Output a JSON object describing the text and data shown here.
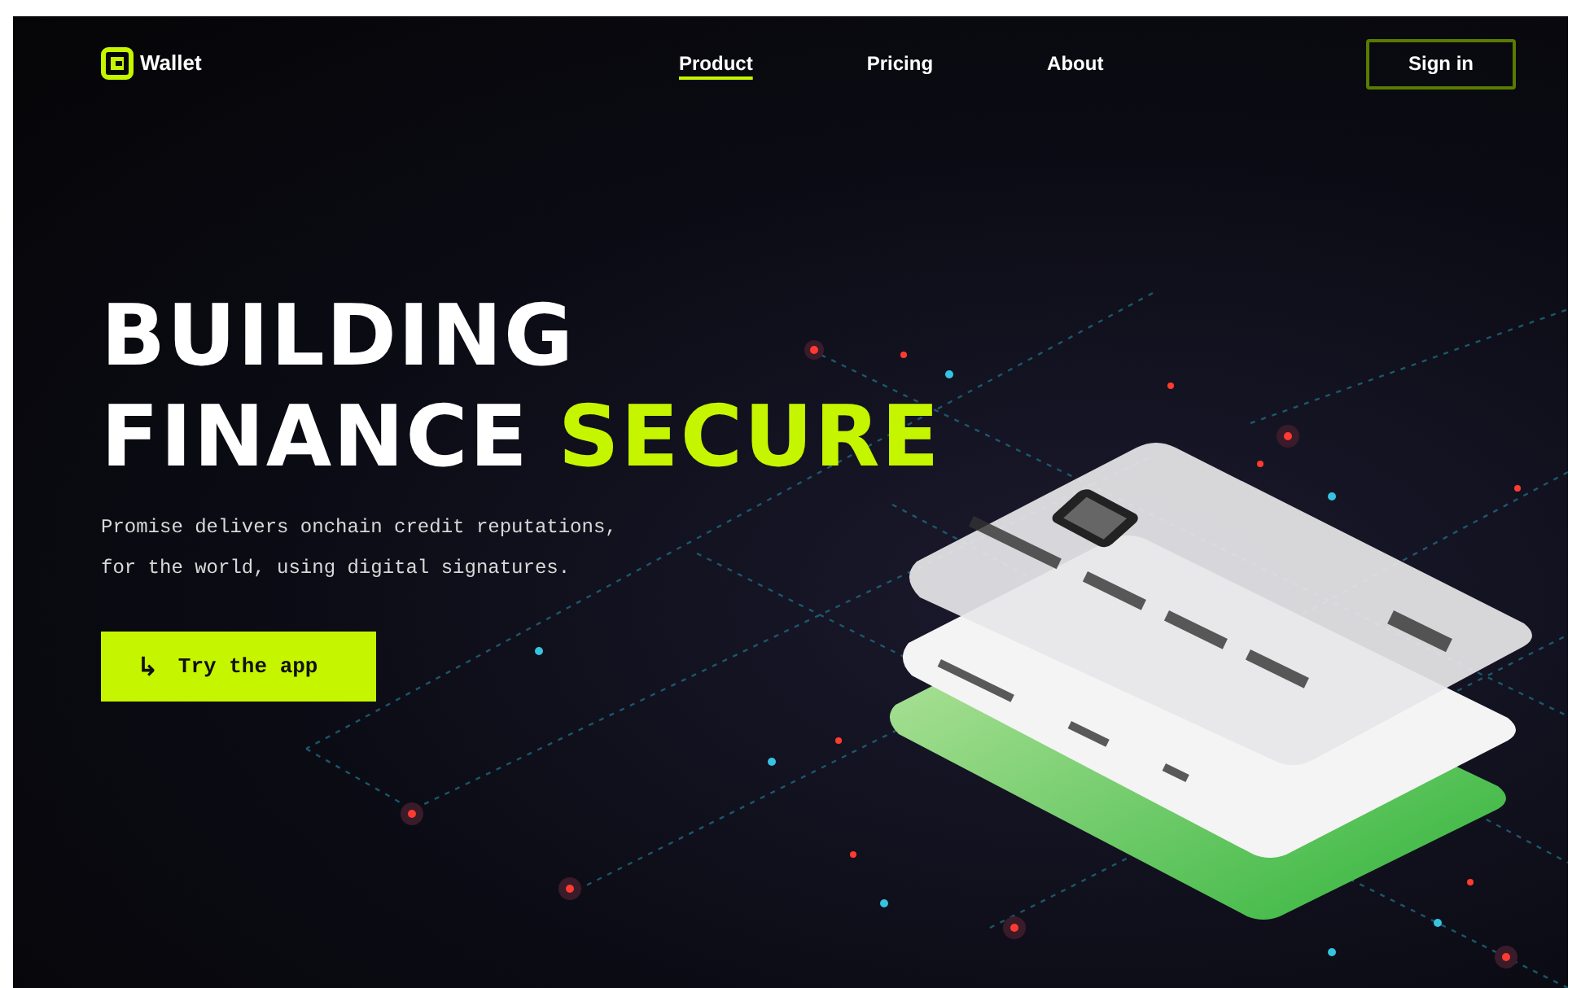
{
  "brand": {
    "name": "Wallet"
  },
  "nav": [
    {
      "label": "Product",
      "selected": true
    },
    {
      "label": "Pricing",
      "selected": false
    },
    {
      "label": "About",
      "selected": false
    }
  ],
  "sign_in": "Sign in",
  "headline": {
    "line1": "BUILDING",
    "line2_plain": "FINANCE",
    "line2_accent": "SECURE"
  },
  "description": "Promise delivers onchain credit reputations,\nfor the world, using digital signatures.",
  "cta": {
    "icon": "↳",
    "label": "Try the app"
  }
}
